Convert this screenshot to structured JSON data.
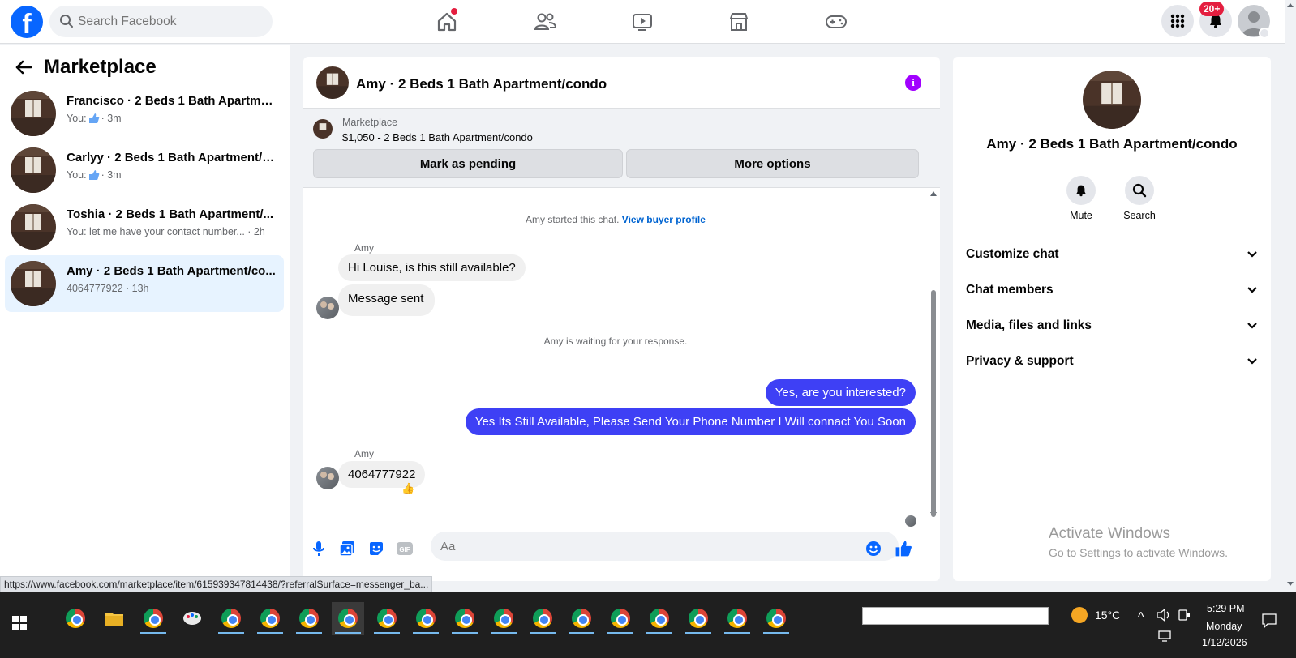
{
  "topbar": {
    "search_placeholder": "Search Facebook",
    "notif_count": "20+"
  },
  "sidebar": {
    "title": "Marketplace",
    "conversations": [
      {
        "name": "Francisco · 2 Beds 1 Bath Apartme...",
        "prefix": "You:",
        "icon": "thumbs-up-icon",
        "time": "· 3m"
      },
      {
        "name": "Carlyy · 2 Beds 1 Bath Apartment/c...",
        "prefix": "You:",
        "icon": "thumbs-up-icon",
        "time": "· 3m"
      },
      {
        "name": "Toshia · 2 Beds 1 Bath Apartment/...",
        "preview": "You: let me have your contact number... · 2h"
      },
      {
        "name": "Amy · 2 Beds 1 Bath Apartment/co...",
        "preview": "4064777922 · 13h",
        "active": true
      }
    ]
  },
  "chat": {
    "title": "Amy · 2 Beds 1 Bath Apartment/condo",
    "marketplace_label": "Marketplace",
    "listing": "$1,050 - 2 Beds 1 Bath Apartment/condo",
    "mark_pending": "Mark as pending",
    "more_options": "More options",
    "started_text": "Amy started this chat.",
    "view_profile": "View buyer profile",
    "sender1": "Amy",
    "msg1": "Hi Louise, is this still available?",
    "msg2": "Message sent",
    "waiting": "Amy is waiting for your response.",
    "out1": "Yes, are you interested?",
    "out2": "Yes Its Still Available, Please Send Your Phone Number I Will connact You Soon",
    "sender2": "Amy",
    "msg3": "4064777922",
    "reaction": "👍",
    "input_placeholder": "Aa"
  },
  "right_panel": {
    "title": "Amy · 2 Beds 1 Bath Apartment/condo",
    "mute": "Mute",
    "search": "Search",
    "rows": [
      "Customize chat",
      "Chat members",
      "Media, files and links",
      "Privacy & support"
    ]
  },
  "watermark": {
    "line1": "Activate Windows",
    "line2": "Go to Settings to activate Windows."
  },
  "status_url": "https://www.facebook.com/marketplace/item/615939347814438/?referralSurface=messenger_ba...",
  "taskbar": {
    "temperature": "15°C",
    "time": "5:29 PM",
    "day": "Monday",
    "date": "1/12/2026"
  },
  "colors": {
    "brand": "#0866ff",
    "outgoing_bubble": "#3e40f5",
    "info_icon": "#a100ff"
  }
}
